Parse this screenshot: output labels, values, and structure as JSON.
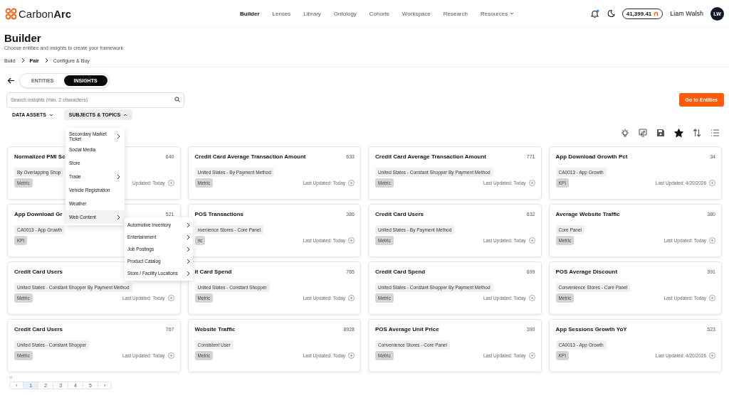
{
  "header": {
    "logo_text": "Carbon",
    "logo_bold": "Arc",
    "nav": [
      {
        "label": "Builder",
        "selected": true,
        "has_caret": false
      },
      {
        "label": "Lenses",
        "selected": false,
        "has_caret": false
      },
      {
        "label": "Library",
        "selected": false,
        "has_caret": false
      },
      {
        "label": "Ontology",
        "selected": false,
        "has_caret": false
      },
      {
        "label": "Cohorts",
        "selected": false,
        "has_caret": false
      },
      {
        "label": "Workspace",
        "selected": false,
        "has_caret": false
      },
      {
        "label": "Research",
        "selected": false,
        "has_caret": false
      },
      {
        "label": "Resources",
        "selected": false,
        "has_caret": true
      }
    ],
    "notifications_unread": true,
    "balance": "41,399.41",
    "user_name": "Liam Walsh",
    "avatar_initials": "LW"
  },
  "page": {
    "title": "Builder",
    "subtitle": "Choose entities and insights to create your framework"
  },
  "breadcrumbs": [
    {
      "label": "Build",
      "selected": false
    },
    {
      "label": "Pair",
      "selected": true
    },
    {
      "label": "Configure & Buy",
      "selected": false
    }
  ],
  "mode_tabs": [
    {
      "label": "ENTITIES",
      "selected": false
    },
    {
      "label": "INSIGHTS",
      "selected": true
    }
  ],
  "search": {
    "placeholder": "Search insights (min. 2 characters)"
  },
  "primary_button": "Go to Entities",
  "filters": [
    {
      "label": "DATA ASSETS",
      "expanded": false
    },
    {
      "label": "SUBJECTS & TOPICS",
      "expanded": true
    }
  ],
  "toolbar": [
    {
      "kind": "bulb",
      "selected": false
    },
    {
      "kind": "swap",
      "selected": false
    },
    {
      "kind": "save",
      "selected": false
    },
    {
      "kind": "star",
      "selected": true
    },
    {
      "kind": "sort",
      "selected": false
    },
    {
      "kind": "list",
      "selected": false
    }
  ],
  "topics_menu": [
    {
      "label": "Secondary Market Ticket",
      "has_children": true,
      "selected": false
    },
    {
      "label": "Social Media",
      "has_children": false,
      "selected": false
    },
    {
      "label": "Store",
      "has_children": false,
      "selected": false
    },
    {
      "label": "Trade",
      "has_children": true,
      "selected": false
    },
    {
      "label": "Vehicle Registration",
      "has_children": false,
      "selected": false
    },
    {
      "label": "Weather",
      "has_children": false,
      "selected": false
    },
    {
      "label": "Web Content",
      "has_children": true,
      "selected": true
    }
  ],
  "web_content_menu": [
    {
      "label": "Automotive Inventory",
      "has_children": true
    },
    {
      "label": "Entertainment",
      "has_children": true
    },
    {
      "label": "Job Postings",
      "has_children": true
    },
    {
      "label": "Product Catalog",
      "has_children": true
    },
    {
      "label": "Store / Facility Locations",
      "has_children": true
    }
  ],
  "cards": [
    {
      "title": "Normalized PMI Sc",
      "count": "640",
      "tag": "By Overlapping Shop",
      "kind": "Metric",
      "updated": "Updated: Today"
    },
    {
      "title": "Credit Card Average Transaction Amount",
      "count": "633",
      "tag": "United States - By Payment Method",
      "kind": "Metric",
      "updated": "Last Updated: Today"
    },
    {
      "title": "Credit Card Average Transaction Amount",
      "count": "771",
      "tag": "United States - Constant Shopper By Payment Method",
      "kind": "Metric",
      "updated": "Last Updated: Today"
    },
    {
      "title": "App Download Growth Pct",
      "count": "34",
      "tag": "CA0013 - App Growth",
      "kind": "KPI",
      "updated": "Last Updated: 4/20/2026"
    },
    {
      "title": "App Download Gr",
      "count": "521",
      "tag": "CA0013 - App Growth",
      "kind": "KPI"
    },
    {
      "title": "POS Transactions",
      "count": "386",
      "tag": "nvenience Stores - Core Panel",
      "kind": "ric",
      "updated": "Last Updated: Today"
    },
    {
      "title": "Credit Card Users",
      "count": "632",
      "tag": "United States - By Payment Method",
      "kind": "Metric",
      "updated": "Last Updated: Today"
    },
    {
      "title": "Average Website Traffic",
      "count": "380",
      "tag": "Core Panel",
      "kind": "Metric",
      "updated": "Last Updated: Today"
    },
    {
      "title": "Credit Card Users",
      "tag": "United States - Constant Shopper By Payment Method",
      "kind": "Metric",
      "updated": "Last Updated: Today"
    },
    {
      "title": "it Card Spend",
      "count": "765",
      "tag": "United States - Constant Shopper",
      "kind": "Metric",
      "updated": "Last Updated: Today"
    },
    {
      "title": "Credit Card Spend",
      "count": "699",
      "tag": "United States - Constant Shopper By Payment Method",
      "kind": "Metric",
      "updated": "Last Updated: Today"
    },
    {
      "title": "POS Average Discount",
      "count": "391",
      "tag": "Convenience Stores - Core Panel",
      "kind": "Metric",
      "updated": "Last Updated: Today"
    },
    {
      "title": "Credit Card Users",
      "count": "767",
      "tag": "United States - Constant Shopper",
      "kind": "Metric",
      "updated": "Last Updated: Today"
    },
    {
      "title": "Website Traffic",
      "count": "8928",
      "tag": "Consistent User",
      "kind": "Metric",
      "updated": "Last Updated: Today"
    },
    {
      "title": "POS Average Unit Price",
      "count": "390",
      "tag": "Convenience Stores - Core Panel",
      "kind": "Metric",
      "updated": "Last Updated: Today"
    },
    {
      "title": "App Sessions Growth YoY",
      "count": "523",
      "tag": "CA0013 - App Growth",
      "kind": "KPI",
      "updated": "Last Updated: 4/20/2026"
    }
  ],
  "pagination": {
    "first": "«",
    "prev": "‹",
    "next": "›",
    "pages": [
      {
        "label": "1",
        "selected": true
      },
      {
        "label": "2",
        "selected": false
      },
      {
        "label": "3",
        "selected": false
      },
      {
        "label": "4",
        "selected": false
      },
      {
        "label": "5",
        "selected": false
      }
    ]
  }
}
